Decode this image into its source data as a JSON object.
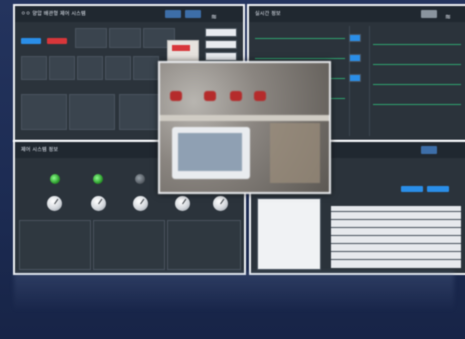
{
  "panels": {
    "top_left": {
      "title": "ㅇㅇ 양압 배관형 제어 시스템"
    },
    "top_right": {
      "title": "실시간 정보"
    },
    "bottom_left": {
      "title": "제어 시스템 정보"
    }
  },
  "icons": [
    "wifi-icon",
    "home-icon",
    "knob-icon",
    "lamp-icon"
  ],
  "colors": {
    "accent": "#2a8ee8",
    "alarm": "#d8363a",
    "ok": "#3ccf5a",
    "panel_bg": "#2b333b",
    "page_bg": "#1c2b52"
  }
}
